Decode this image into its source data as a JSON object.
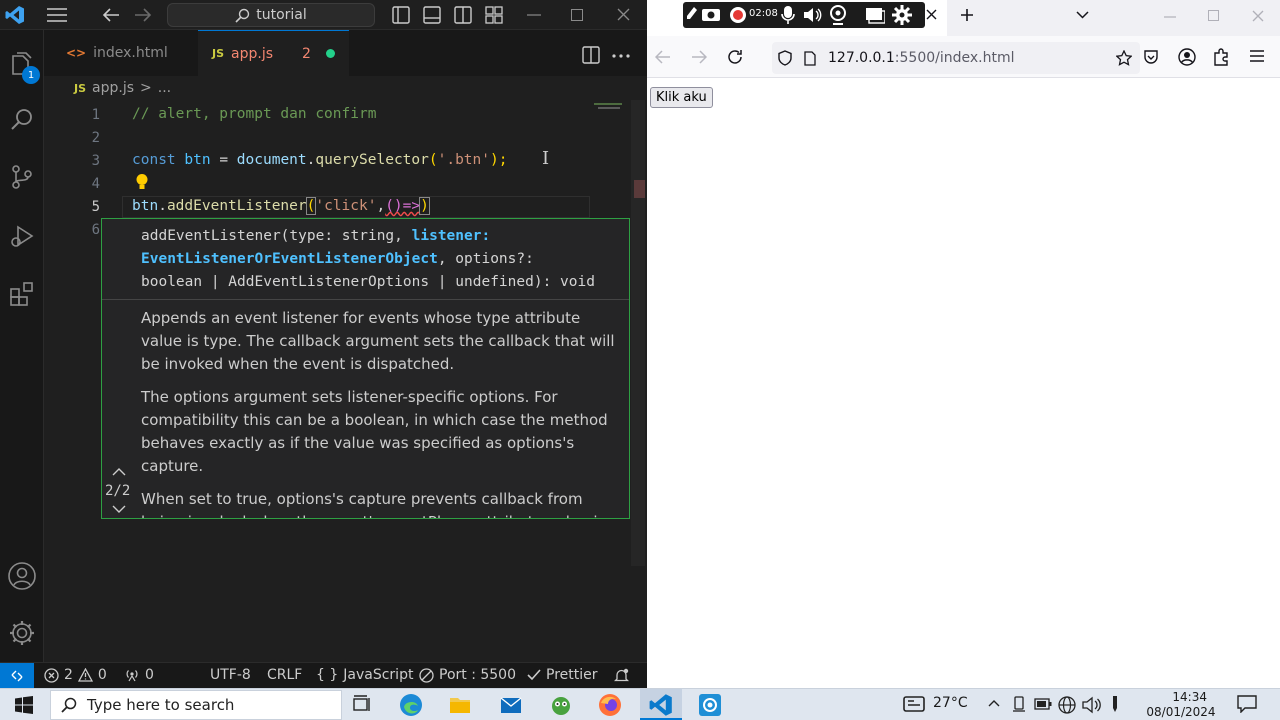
{
  "vscode": {
    "search_text": "tutorial",
    "tabs": [
      {
        "icon": "<>",
        "name": "index.html",
        "active": false
      },
      {
        "icon": "JS",
        "name": "app.js",
        "problems": "2",
        "active": true
      }
    ],
    "breadcrumb": {
      "icon": "JS",
      "file": "app.js",
      "sep": ">",
      "more": "..."
    },
    "explorer_badge": "1",
    "code": {
      "line1": "// alert, prompt dan confirm",
      "line3": {
        "kw": "const",
        "var": "btn",
        "eq": " = ",
        "obj": "document",
        "dot": ".",
        "fn": "querySelector",
        "open": "(",
        "str": "'.btn'",
        "close": ");"
      },
      "line5": {
        "obj": "btn",
        "dot": ".",
        "fn": "addEventListener",
        "open": "(",
        "str": "'click'",
        "comma": ",",
        "arrow": "()=>",
        "close": ")"
      }
    },
    "line_numbers": [
      "1",
      "2",
      "3",
      "4",
      "5",
      "6"
    ],
    "hover": {
      "sig_a": "addEventListener(type: string, ",
      "sig_b": "listener:",
      "sig_c": "EventListenerOrEventListenerObject",
      "sig_d": ", options?:",
      "sig_e": "boolean | AddEventListenerOptions | undefined): void",
      "overload": "2/2",
      "doc": [
        "Appends an event listener for events whose type attribute value is type. The callback argument sets the callback that will be invoked when the event is dispatched.",
        "The options argument sets listener-specific options. For compatibility this can be a boolean, in which case the method behaves exactly as if the value was specified as options's capture.",
        "When set to true, options's capture prevents callback from being invoked when the event's eventPhase attribute value is"
      ]
    },
    "status": {
      "errors": "2",
      "warnings": "0",
      "ports": "0",
      "encoding": "UTF-8",
      "eol": "CRLF",
      "language_braces": "{ }",
      "language": "JavaScript",
      "port": "Port : 5500",
      "prettier": "Prettier"
    }
  },
  "browser": {
    "recorder_time": "02:08",
    "url_host": "127.0.0.1",
    "url_path": ":5500/index.html",
    "page_button": "Klik aku"
  },
  "taskbar": {
    "search_placeholder": "Type here to search",
    "temperature": "27°C",
    "time": "14:34",
    "date": "08/01/2024"
  },
  "colors": {
    "accent_blue": "#0078d4",
    "keyword": "#569cd6",
    "function": "#dcdcaa",
    "string": "#ce9178",
    "variable": "#9cdcfe",
    "comment": "#6a9955",
    "hover_border": "#2ea043"
  }
}
